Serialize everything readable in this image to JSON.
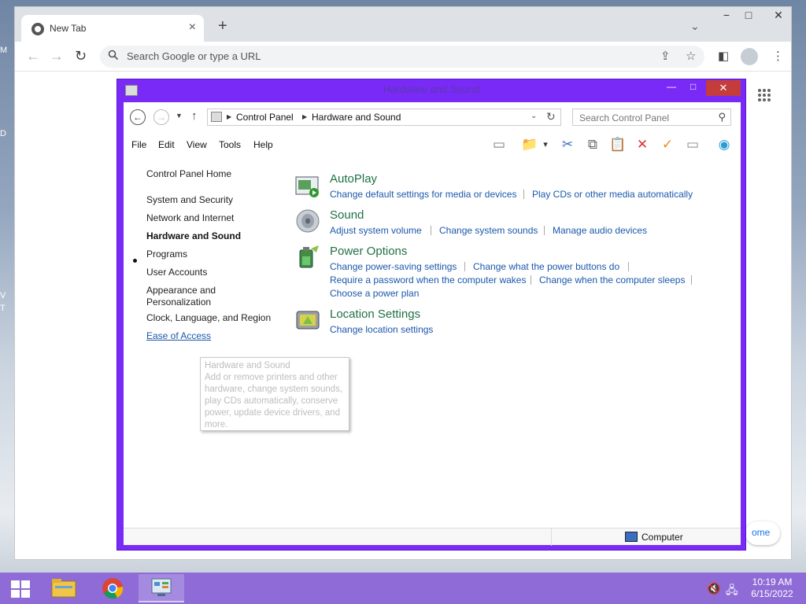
{
  "desktop": {
    "fragments": [
      "M",
      "D",
      "V",
      "T"
    ]
  },
  "browser": {
    "tab_title": "New Tab",
    "close_tab": "×",
    "new_tab": "+",
    "tab_search": "⌄",
    "window_controls": {
      "minimize": "−",
      "maximize": "□",
      "close": "✕"
    },
    "back": "←",
    "forward": "→",
    "reload": "↻",
    "omnibox_placeholder": "Search Google or type a URL",
    "share": "⇪",
    "bookmark": "☆",
    "side_panel": "◧",
    "menu": "⋮",
    "customize_label": "ome"
  },
  "control_panel": {
    "window_title": "Hardware and Sound",
    "title_buttons": {
      "minimize": "—",
      "maximize": "□",
      "close": "✕"
    },
    "address": {
      "back": "←",
      "forward": "→",
      "history": "▼",
      "up": "↑",
      "crumbs": [
        "Control Panel",
        "Hardware and Sound"
      ],
      "dropdown": "⌄",
      "refresh": "↻"
    },
    "search_placeholder": "Search Control Panel",
    "search_icon": "⚲",
    "menu": [
      "File",
      "Edit",
      "View",
      "Tools",
      "Help"
    ],
    "toolbar_icons": [
      "▭",
      "📁",
      "▾",
      "✂",
      "⧉",
      "📋",
      "✕",
      "✓",
      "▭",
      "◉"
    ],
    "nav": {
      "home": "Control Panel Home",
      "items": [
        "System and Security",
        "Network and Internet",
        "Hardware and Sound",
        "Programs",
        "User Accounts",
        "Appearance and Personalization",
        "Clock, Language, and Region",
        "Ease of Access"
      ],
      "current_index": 2
    },
    "categories": [
      {
        "title": "AutoPlay",
        "icon": "autoplay-icon",
        "links": [
          "Change default settings for media or devices",
          "Play CDs or other media automatically"
        ]
      },
      {
        "title": "Sound",
        "icon": "speaker-icon",
        "links": [
          "Adjust system volume",
          "Change system sounds",
          "Manage audio devices"
        ]
      },
      {
        "title": "Power Options",
        "icon": "battery-icon",
        "links": [
          "Change power-saving settings",
          "Change what the power buttons do",
          "Require a password when the computer wakes",
          "Change when the computer sleeps",
          "Choose a power plan"
        ]
      },
      {
        "title": "Location Settings",
        "icon": "location-device-icon",
        "links": [
          "Change location settings"
        ]
      }
    ],
    "tooltip": {
      "title": "Hardware and Sound",
      "body": "Add or remove printers and other hardware, change system sounds, play CDs automatically, conserve power, update device drivers, and more."
    },
    "status": "Computer"
  },
  "taskbar": {
    "tray": {
      "volume": "🔇",
      "network": "🖧"
    },
    "time": "10:19 AM",
    "date": "6/15/2022"
  },
  "colors": {
    "window_frame": "#7a2af7",
    "taskbar": "#8e6bd6",
    "link": "#1a58ac",
    "category_title": "#1e7145",
    "close_button": "#c43c3c"
  }
}
